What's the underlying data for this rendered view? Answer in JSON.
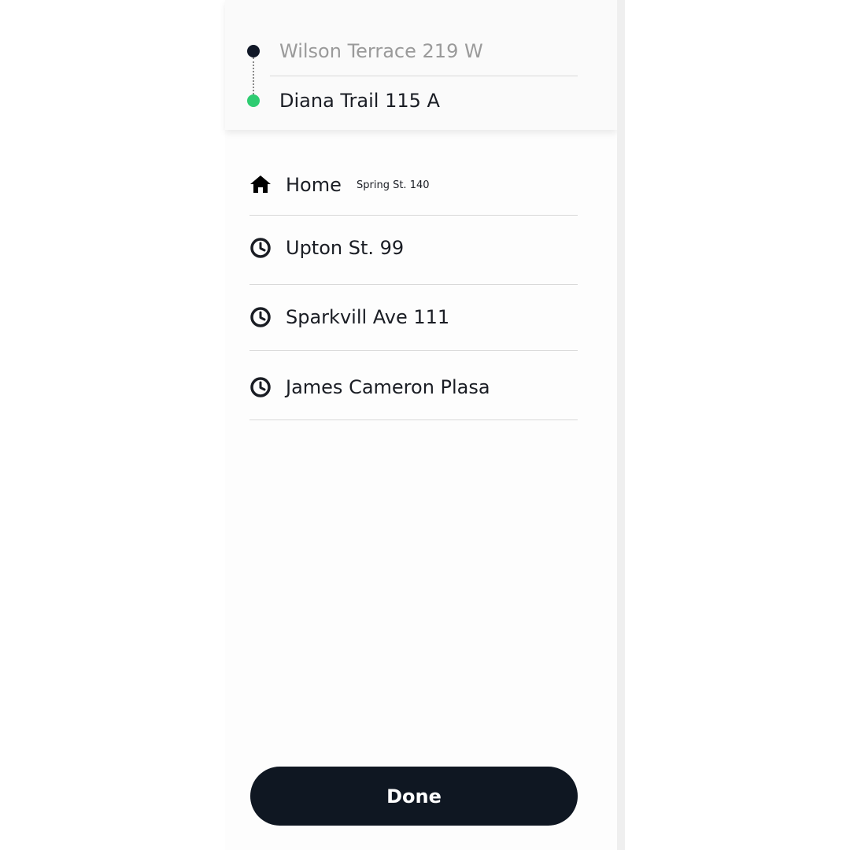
{
  "route": {
    "origin": "Wilson Terrace 219 W",
    "destination": "Diana Trail 115 A",
    "origin_color": "#111827",
    "destination_color": "#2ecc71"
  },
  "places": [
    {
      "icon": "home-icon",
      "label": "Home",
      "sublabel": "Spring St. 140"
    },
    {
      "icon": "clock-icon",
      "label": "Upton St. 99"
    },
    {
      "icon": "clock-icon",
      "label": "Sparkvill Ave 111"
    },
    {
      "icon": "clock-icon",
      "label": "James Cameron Plasa"
    }
  ],
  "done_button": {
    "label": "Done",
    "color": "#0f1722"
  }
}
